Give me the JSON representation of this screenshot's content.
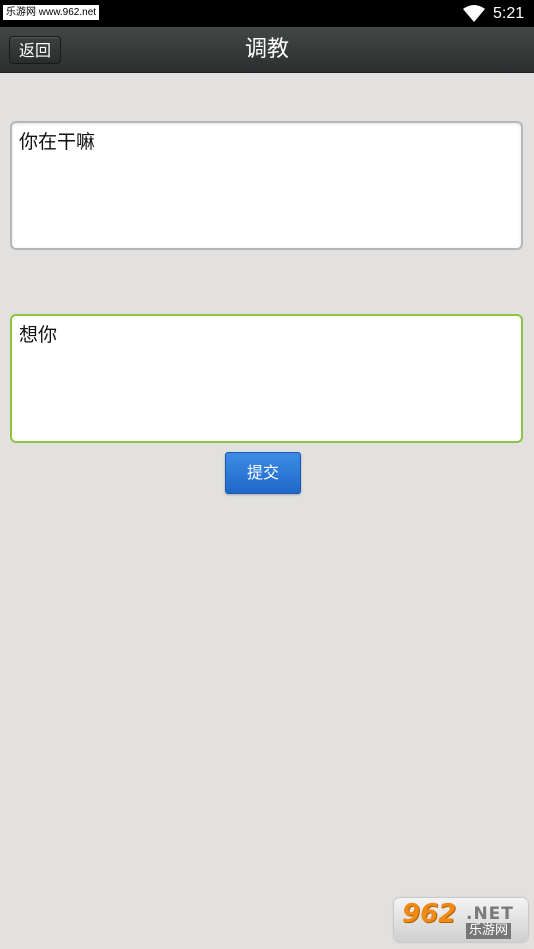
{
  "status_bar": {
    "watermark": "乐游网 www.962.net",
    "time": "5:21"
  },
  "header": {
    "back_label": "返回",
    "title": "调教"
  },
  "form": {
    "question_value": "你在干嘛",
    "answer_value": "想你",
    "submit_label": "提交"
  },
  "logo_watermark": {
    "number": "962",
    "suffix": ".NET",
    "name": "乐游网"
  },
  "colors": {
    "titlebar": "#2c2f2f",
    "background": "#e2e1df",
    "active_border": "#8cc33f",
    "button": "#1f67c8"
  }
}
